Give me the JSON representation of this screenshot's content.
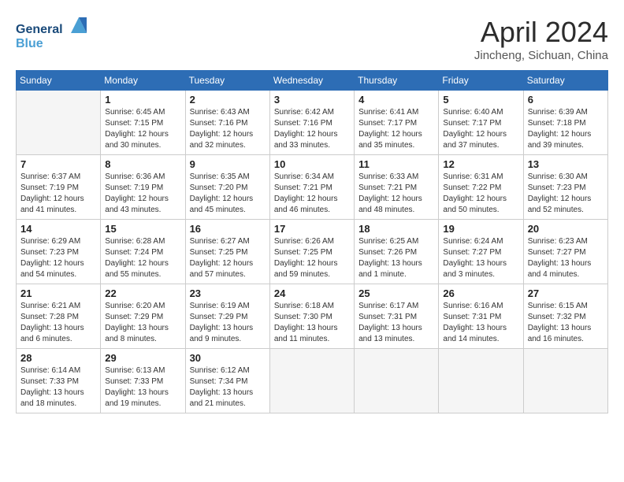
{
  "header": {
    "logo_general": "General",
    "logo_blue": "Blue",
    "month_title": "April 2024",
    "location": "Jincheng, Sichuan, China"
  },
  "days_of_week": [
    "Sunday",
    "Monday",
    "Tuesday",
    "Wednesday",
    "Thursday",
    "Friday",
    "Saturday"
  ],
  "weeks": [
    [
      {
        "day": "",
        "empty": true
      },
      {
        "day": "1",
        "sunrise": "6:45 AM",
        "sunset": "7:15 PM",
        "daylight": "12 hours and 30 minutes."
      },
      {
        "day": "2",
        "sunrise": "6:43 AM",
        "sunset": "7:16 PM",
        "daylight": "12 hours and 32 minutes."
      },
      {
        "day": "3",
        "sunrise": "6:42 AM",
        "sunset": "7:16 PM",
        "daylight": "12 hours and 33 minutes."
      },
      {
        "day": "4",
        "sunrise": "6:41 AM",
        "sunset": "7:17 PM",
        "daylight": "12 hours and 35 minutes."
      },
      {
        "day": "5",
        "sunrise": "6:40 AM",
        "sunset": "7:17 PM",
        "daylight": "12 hours and 37 minutes."
      },
      {
        "day": "6",
        "sunrise": "6:39 AM",
        "sunset": "7:18 PM",
        "daylight": "12 hours and 39 minutes."
      }
    ],
    [
      {
        "day": "7",
        "sunrise": "6:37 AM",
        "sunset": "7:19 PM",
        "daylight": "12 hours and 41 minutes."
      },
      {
        "day": "8",
        "sunrise": "6:36 AM",
        "sunset": "7:19 PM",
        "daylight": "12 hours and 43 minutes."
      },
      {
        "day": "9",
        "sunrise": "6:35 AM",
        "sunset": "7:20 PM",
        "daylight": "12 hours and 45 minutes."
      },
      {
        "day": "10",
        "sunrise": "6:34 AM",
        "sunset": "7:21 PM",
        "daylight": "12 hours and 46 minutes."
      },
      {
        "day": "11",
        "sunrise": "6:33 AM",
        "sunset": "7:21 PM",
        "daylight": "12 hours and 48 minutes."
      },
      {
        "day": "12",
        "sunrise": "6:31 AM",
        "sunset": "7:22 PM",
        "daylight": "12 hours and 50 minutes."
      },
      {
        "day": "13",
        "sunrise": "6:30 AM",
        "sunset": "7:23 PM",
        "daylight": "12 hours and 52 minutes."
      }
    ],
    [
      {
        "day": "14",
        "sunrise": "6:29 AM",
        "sunset": "7:23 PM",
        "daylight": "12 hours and 54 minutes."
      },
      {
        "day": "15",
        "sunrise": "6:28 AM",
        "sunset": "7:24 PM",
        "daylight": "12 hours and 55 minutes."
      },
      {
        "day": "16",
        "sunrise": "6:27 AM",
        "sunset": "7:25 PM",
        "daylight": "12 hours and 57 minutes."
      },
      {
        "day": "17",
        "sunrise": "6:26 AM",
        "sunset": "7:25 PM",
        "daylight": "12 hours and 59 minutes."
      },
      {
        "day": "18",
        "sunrise": "6:25 AM",
        "sunset": "7:26 PM",
        "daylight": "13 hours and 1 minute."
      },
      {
        "day": "19",
        "sunrise": "6:24 AM",
        "sunset": "7:27 PM",
        "daylight": "13 hours and 3 minutes."
      },
      {
        "day": "20",
        "sunrise": "6:23 AM",
        "sunset": "7:27 PM",
        "daylight": "13 hours and 4 minutes."
      }
    ],
    [
      {
        "day": "21",
        "sunrise": "6:21 AM",
        "sunset": "7:28 PM",
        "daylight": "13 hours and 6 minutes."
      },
      {
        "day": "22",
        "sunrise": "6:20 AM",
        "sunset": "7:29 PM",
        "daylight": "13 hours and 8 minutes."
      },
      {
        "day": "23",
        "sunrise": "6:19 AM",
        "sunset": "7:29 PM",
        "daylight": "13 hours and 9 minutes."
      },
      {
        "day": "24",
        "sunrise": "6:18 AM",
        "sunset": "7:30 PM",
        "daylight": "13 hours and 11 minutes."
      },
      {
        "day": "25",
        "sunrise": "6:17 AM",
        "sunset": "7:31 PM",
        "daylight": "13 hours and 13 minutes."
      },
      {
        "day": "26",
        "sunrise": "6:16 AM",
        "sunset": "7:31 PM",
        "daylight": "13 hours and 14 minutes."
      },
      {
        "day": "27",
        "sunrise": "6:15 AM",
        "sunset": "7:32 PM",
        "daylight": "13 hours and 16 minutes."
      }
    ],
    [
      {
        "day": "28",
        "sunrise": "6:14 AM",
        "sunset": "7:33 PM",
        "daylight": "13 hours and 18 minutes."
      },
      {
        "day": "29",
        "sunrise": "6:13 AM",
        "sunset": "7:33 PM",
        "daylight": "13 hours and 19 minutes."
      },
      {
        "day": "30",
        "sunrise": "6:12 AM",
        "sunset": "7:34 PM",
        "daylight": "13 hours and 21 minutes."
      },
      {
        "day": "",
        "empty": true
      },
      {
        "day": "",
        "empty": true
      },
      {
        "day": "",
        "empty": true
      },
      {
        "day": "",
        "empty": true
      }
    ]
  ],
  "labels": {
    "sunrise": "Sunrise:",
    "sunset": "Sunset:",
    "daylight": "Daylight:"
  }
}
